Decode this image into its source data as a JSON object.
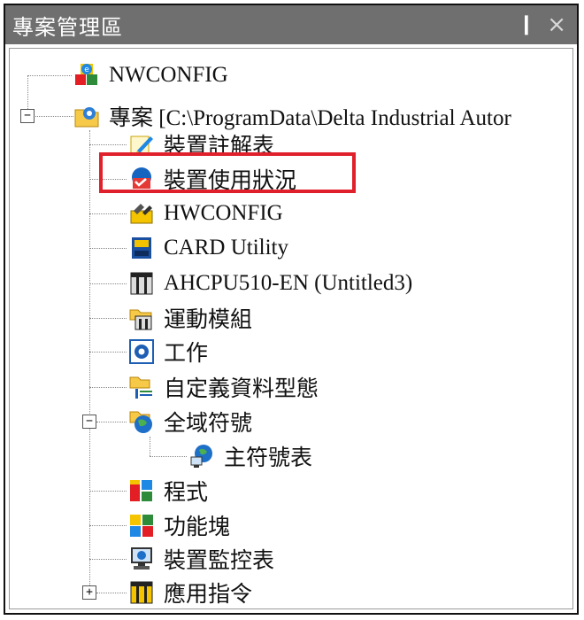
{
  "panel": {
    "title": "專案管理區",
    "pin_glyph": "❙",
    "close_glyph": "×"
  },
  "tree": {
    "root_network": "NWCONFIG",
    "project_label": "專案 [C:\\ProgramData\\Delta Industrial Autor",
    "project_toggle": "−",
    "items": {
      "device_comment": "裝置註解表",
      "device_usage": "裝置使用狀況",
      "hwconfig": "HWCONFIG",
      "card_utility": "CARD Utility",
      "cpu": "AHCPU510-EN  (Untitled3)",
      "motion": "運動模組",
      "task": "工作",
      "user_data_type": "自定義資料型態",
      "global_symbols": "全域符號",
      "global_toggle": "−",
      "main_symbol_table": "主符號表",
      "program": "程式",
      "function_block": "功能塊",
      "device_monitor": "裝置監控表",
      "app_instruction": "應用指令",
      "app_toggle": "+"
    }
  },
  "colors": {
    "titlebar": "#6f6f6f",
    "highlight_border": "#e0202a"
  }
}
